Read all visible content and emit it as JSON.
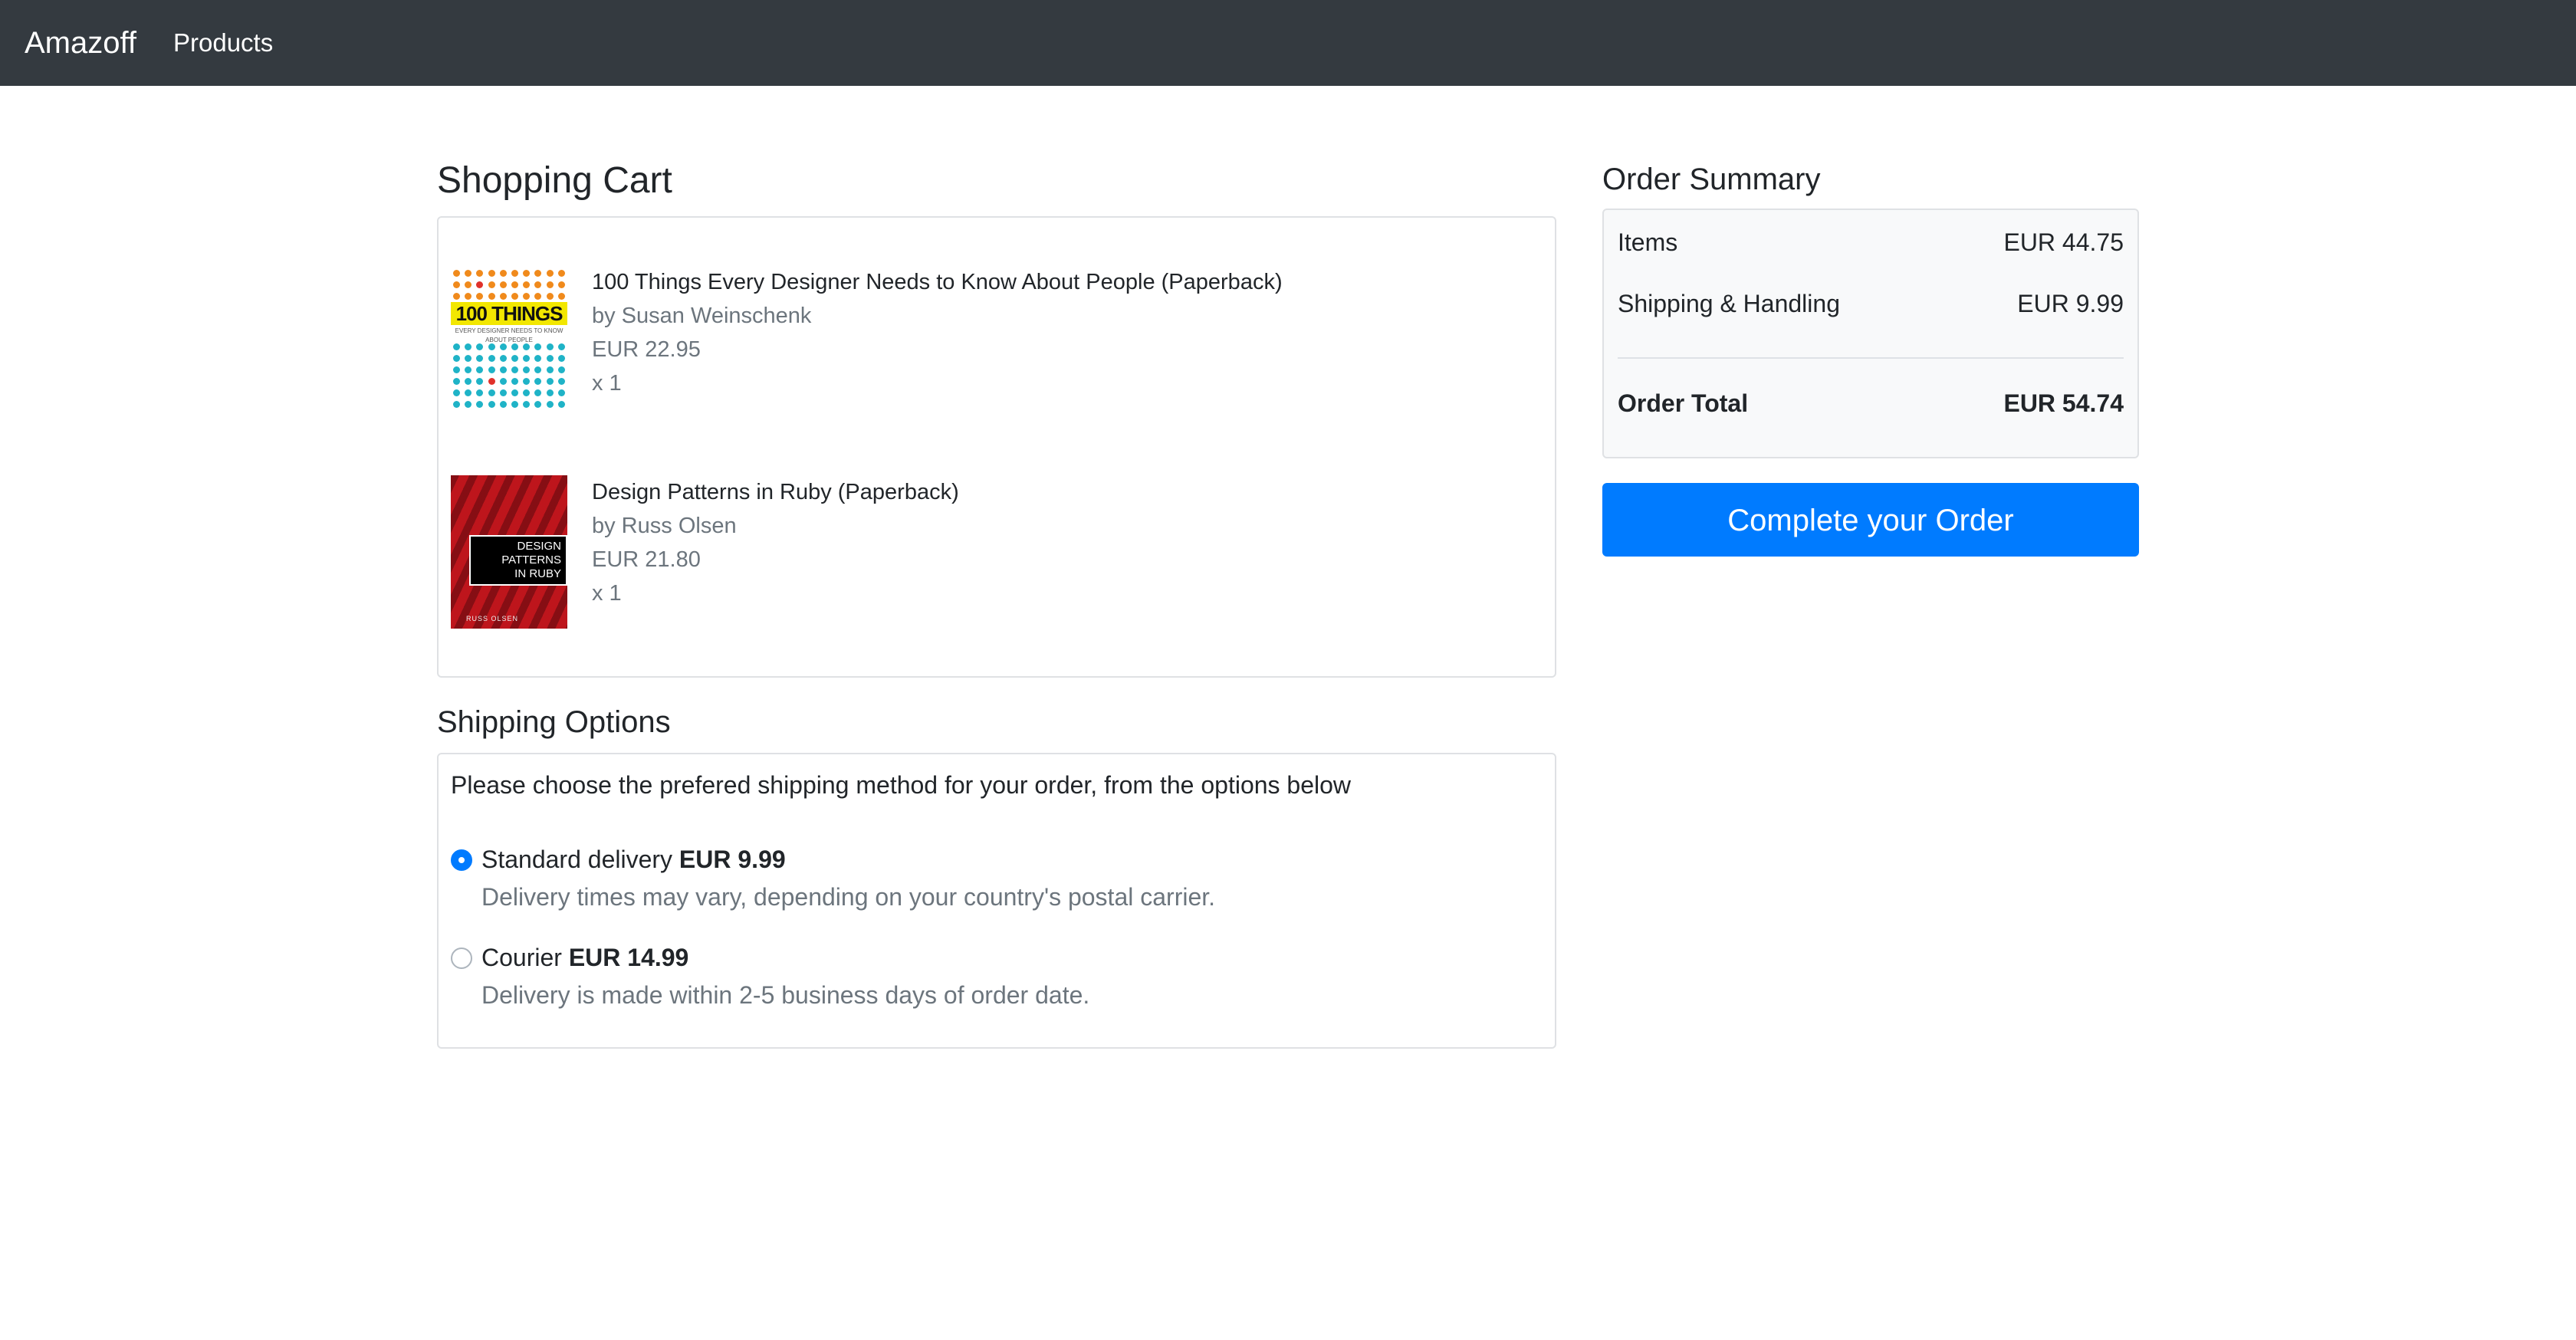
{
  "navbar": {
    "brand": "Amazoff",
    "links": [
      "Products"
    ]
  },
  "cart": {
    "heading": "Shopping Cart",
    "items": [
      {
        "title": "100 Things Every Designer Needs to Know About People (Paperback)",
        "author": "by Susan Weinschenk",
        "price": "EUR 22.95",
        "quantity": "x 1",
        "cover": {
          "title_text": "100 THINGS",
          "subtitle_text": "EVERY DESIGNER NEEDS TO KNOW ABOUT PEOPLE",
          "band_color": "#f2e700",
          "dot_colors": [
            "#f08a1c",
            "#1fb3c7",
            "#e0312b"
          ]
        }
      },
      {
        "title": "Design Patterns in Ruby (Paperback)",
        "author": "by Russ Olsen",
        "price": "EUR 21.80",
        "quantity": "x 1",
        "cover": {
          "title_lines": [
            "DESIGN",
            "PATTERNS",
            "IN RUBY"
          ],
          "author_text": "RUSS OLSEN",
          "background_color": "#b3121a"
        }
      }
    ]
  },
  "shipping": {
    "heading": "Shipping Options",
    "intro": "Please choose the prefered shipping method for your order, from the options below",
    "options": [
      {
        "label": "Standard delivery",
        "price": "EUR 9.99",
        "description": "Delivery times may vary, depending on your country's postal carrier.",
        "selected": true
      },
      {
        "label": "Courier",
        "price": "EUR 14.99",
        "description": "Delivery is made within 2-5 business days of order date.",
        "selected": false
      }
    ]
  },
  "summary": {
    "heading": "Order Summary",
    "rows": [
      {
        "label": "Items",
        "value": "EUR 44.75"
      },
      {
        "label": "Shipping & Handling",
        "value": "EUR 9.99"
      }
    ],
    "total": {
      "label": "Order Total",
      "value": "EUR 54.74"
    },
    "button_label": "Complete your Order"
  },
  "colors": {
    "navbar_bg": "#343a40",
    "primary": "#007bff",
    "muted_text": "#6c757d",
    "summary_bg": "#f8f9fa"
  }
}
